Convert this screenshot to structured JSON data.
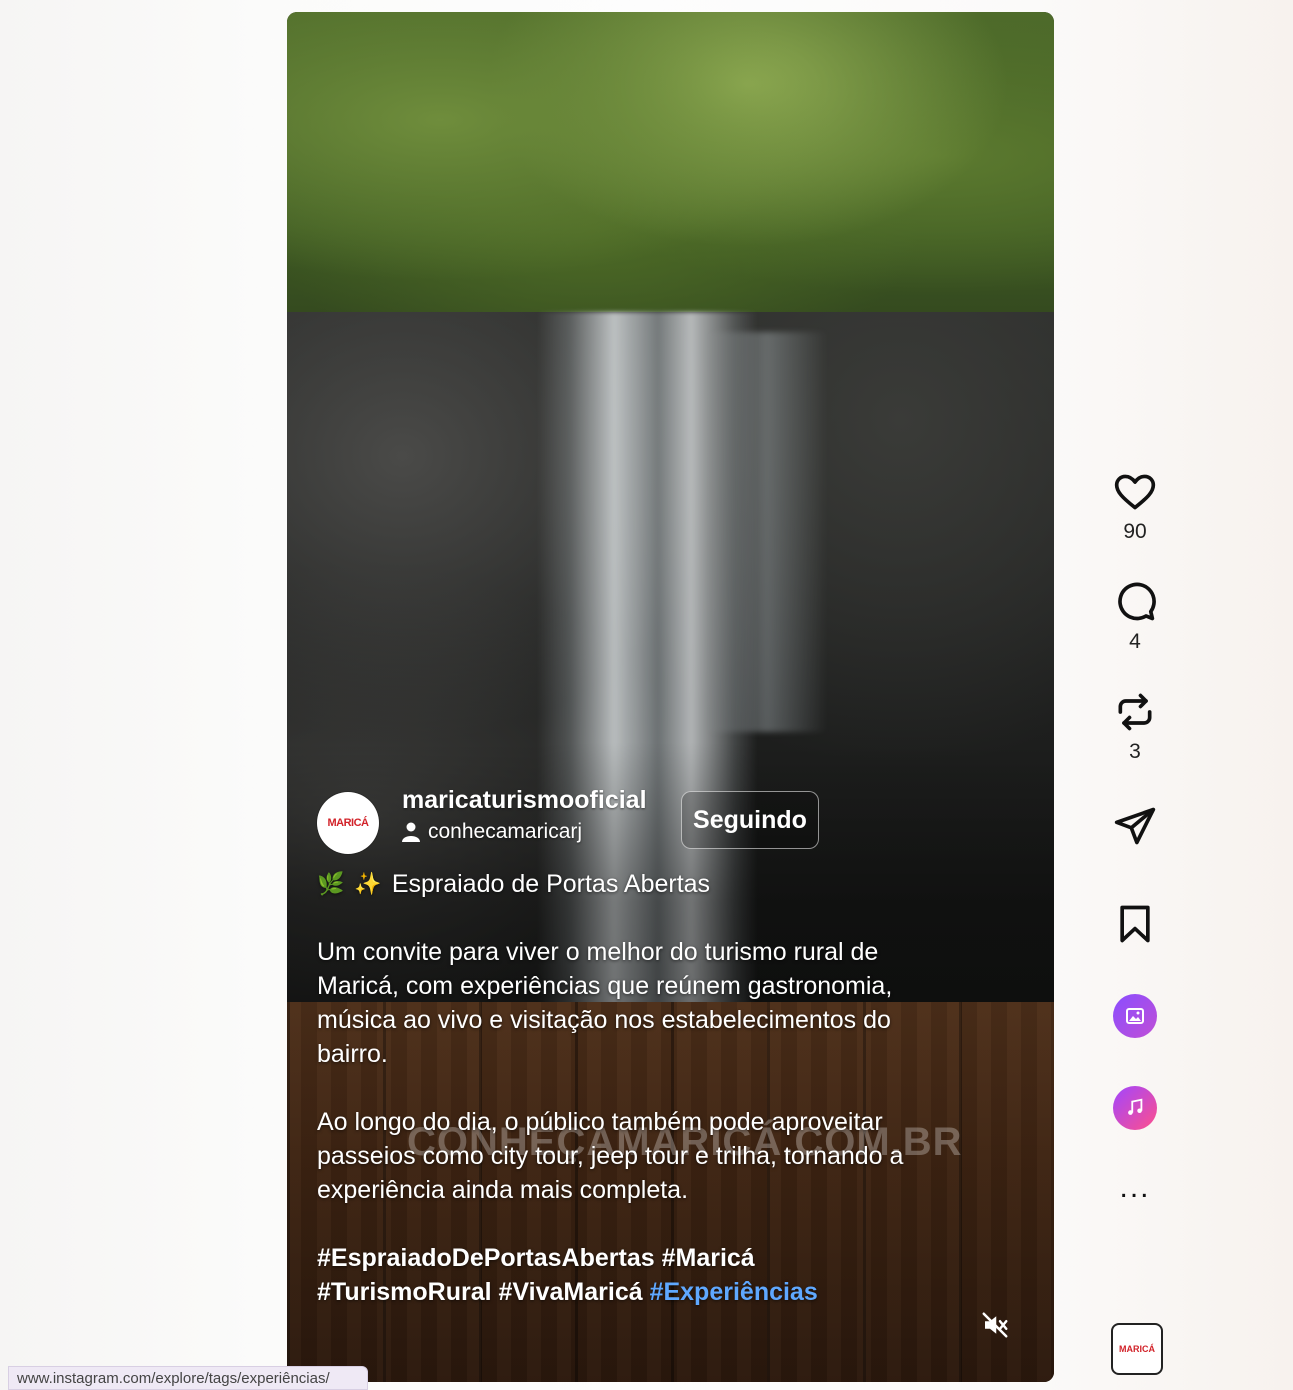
{
  "post": {
    "author": "maricaturismooficial",
    "avatar_logo": "MARICÁ",
    "collaborator": "conhecamaricarj",
    "follow_label": "Seguindo",
    "title_emojis": [
      "🌿",
      "✨"
    ],
    "title": "Espraiado de Portas Abertas",
    "paragraphs": [
      "Um convite para viver o melhor do turismo rural de Maricá, com experiências que reúnem gastronomia, música ao vivo e visitação nos estabelecimentos do bairro.",
      "Ao longo do dia, o público também pode aproveitar passeios como city tour, jeep tour e trilha, tornando a experiência ainda mais completa."
    ],
    "hashtags": [
      "#EspraiadoDePortasAbertas",
      "#Maricá",
      "#TurismoRural",
      "#VivaMaricá",
      "#Experiências"
    ],
    "watermark": "CONHEÇAMARICÁ.COM.BR"
  },
  "actions": {
    "likes": "90",
    "comments": "4",
    "reposts": "3",
    "more": "..."
  },
  "audio_thumb_label": "MARICÁ",
  "status_url": "www.instagram.com/explore/tags/experiências/",
  "icons": {
    "like": "heart-icon",
    "comment": "comment-icon",
    "repost": "repost-icon",
    "share": "send-icon",
    "save": "bookmark-icon",
    "photo": "photo-icon",
    "music": "music-icon",
    "mute": "muted-speaker-icon",
    "collaborator": "person-icon"
  },
  "colors": {
    "link_hashtag": "#5fa8ff",
    "text_dark": "#222222"
  }
}
